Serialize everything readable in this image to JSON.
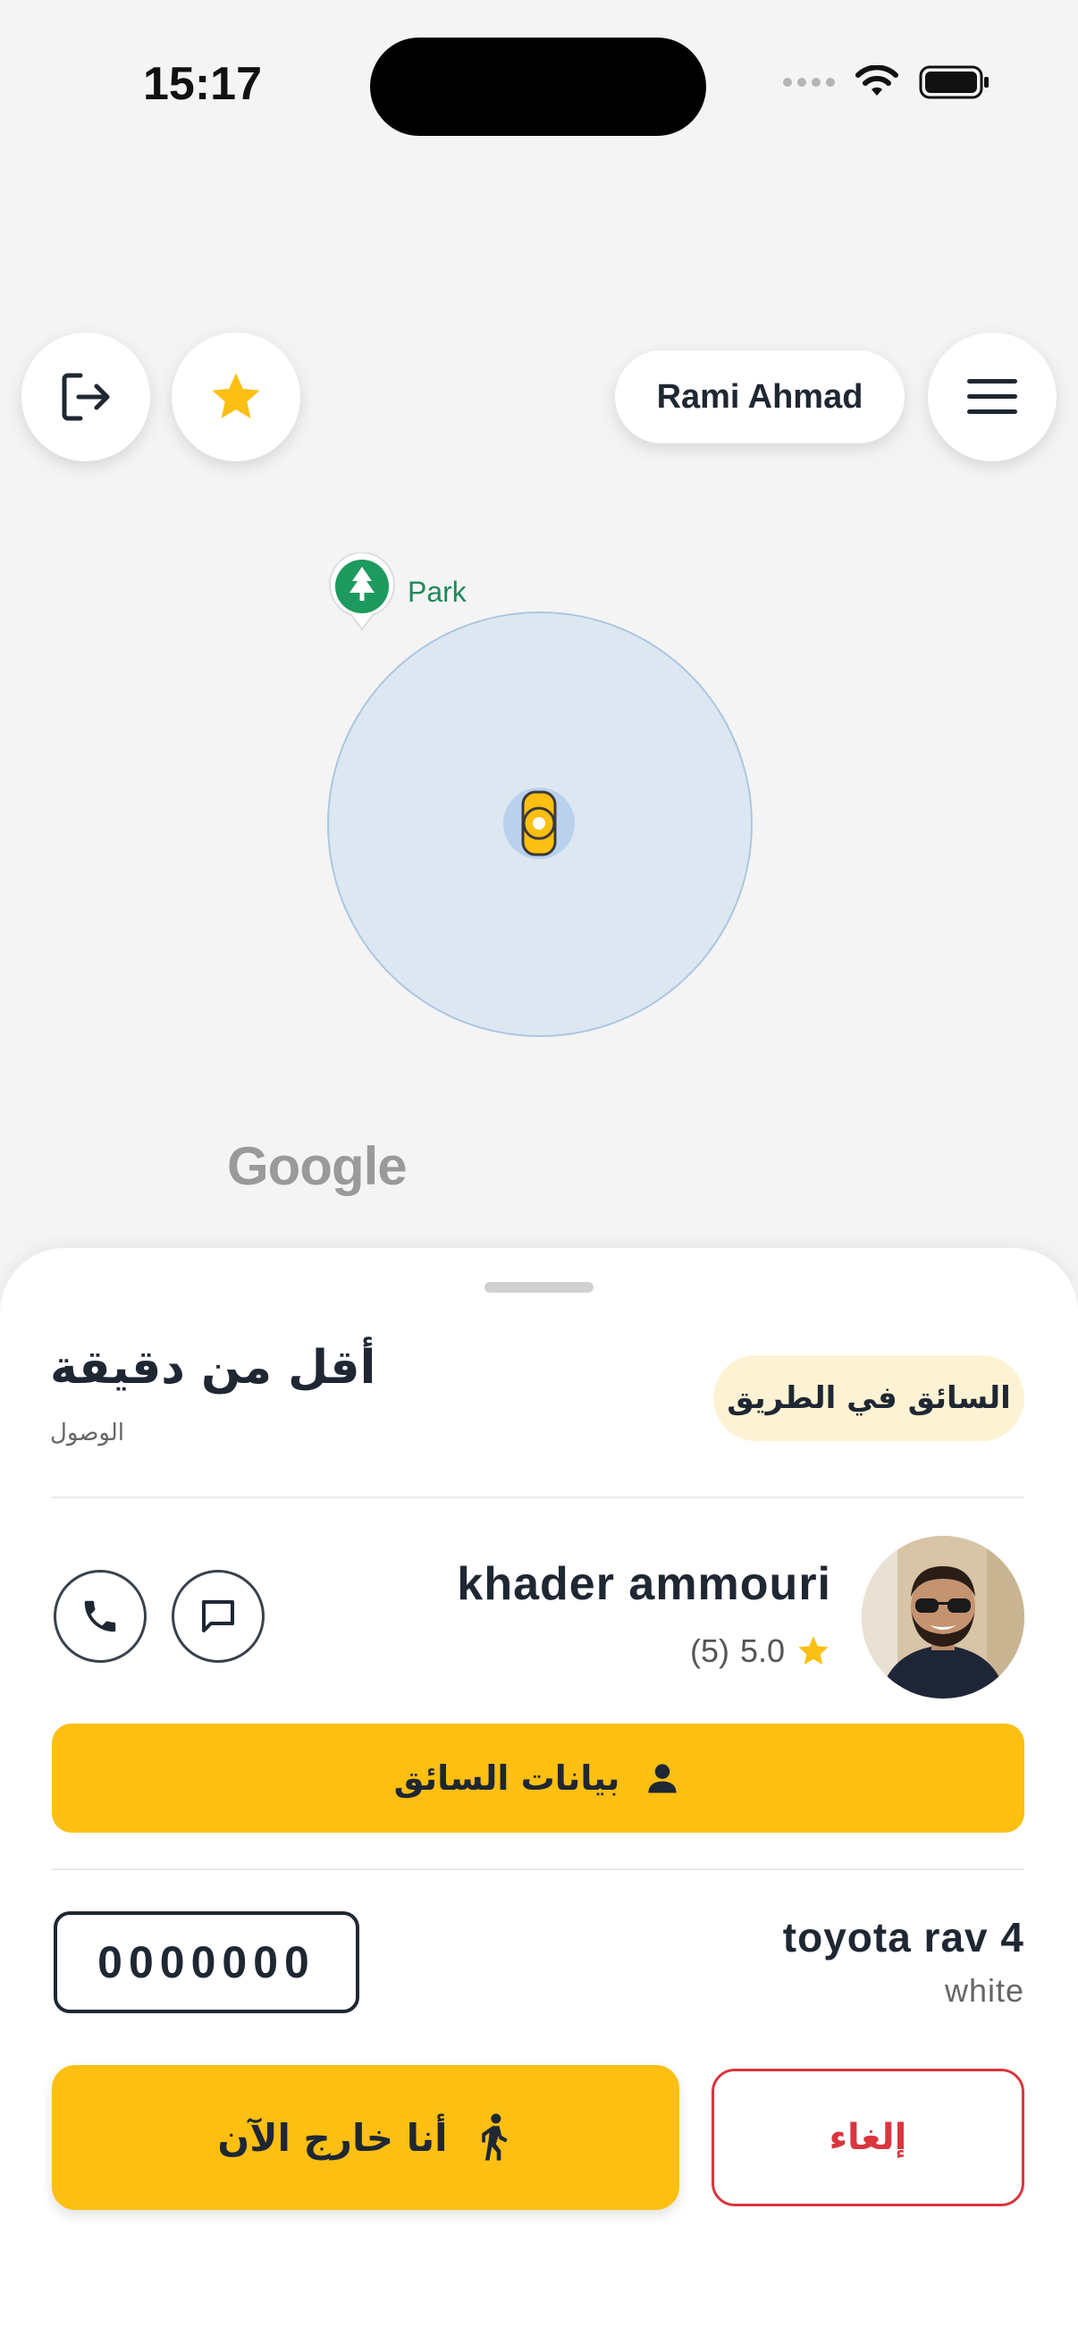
{
  "status_bar": {
    "time": "15:17"
  },
  "map": {
    "user_name": "Rami Ahmad",
    "poi_label": "Park",
    "attribution": "Google"
  },
  "trip": {
    "eta_value": "أقل من دقيقة",
    "eta_label": "الوصول",
    "status": "السائق في الطريق"
  },
  "driver": {
    "name": "khader ammouri",
    "rating": "5.0",
    "rating_count": "(5)",
    "info_button": "بيانات السائق"
  },
  "vehicle": {
    "plate": "0000000",
    "model": "toyota rav 4",
    "color": "white"
  },
  "actions": {
    "outside_label": "أنا خارج الآن",
    "cancel_label": "إلغاء"
  },
  "colors": {
    "accent": "#fcbf12",
    "danger": "#d9363e",
    "badge_bg": "#fdf3d4",
    "text": "#1f2733"
  }
}
